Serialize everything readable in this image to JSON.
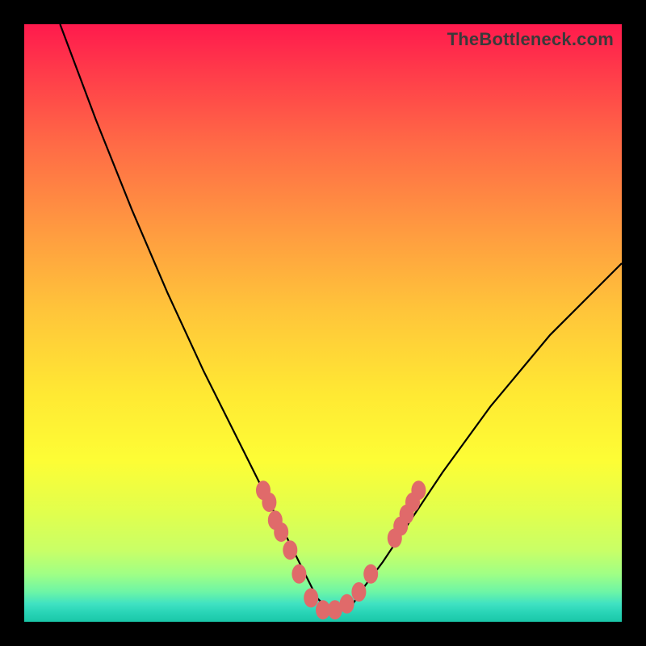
{
  "watermark": "TheBottleneck.com",
  "chart_data": {
    "type": "line",
    "title": "",
    "xlabel": "",
    "ylabel": "",
    "xlim": [
      0,
      100
    ],
    "ylim": [
      0,
      100
    ],
    "series": [
      {
        "name": "curve",
        "x": [
          6,
          12,
          18,
          24,
          30,
          36,
          40,
          44,
          47,
          49,
          51,
          53,
          55,
          57,
          60,
          64,
          70,
          78,
          88,
          100
        ],
        "y": [
          100,
          84,
          69,
          55,
          42,
          30,
          22,
          14,
          8,
          4,
          2,
          2,
          3,
          6,
          10,
          16,
          25,
          36,
          48,
          60
        ]
      }
    ],
    "markers": {
      "name": "highlight-dots",
      "color": "#e06a6a",
      "points": [
        {
          "x": 40,
          "y": 22
        },
        {
          "x": 41,
          "y": 20
        },
        {
          "x": 42,
          "y": 17
        },
        {
          "x": 43,
          "y": 15
        },
        {
          "x": 44.5,
          "y": 12
        },
        {
          "x": 46,
          "y": 8
        },
        {
          "x": 48,
          "y": 4
        },
        {
          "x": 50,
          "y": 2
        },
        {
          "x": 52,
          "y": 2
        },
        {
          "x": 54,
          "y": 3
        },
        {
          "x": 56,
          "y": 5
        },
        {
          "x": 58,
          "y": 8
        },
        {
          "x": 62,
          "y": 14
        },
        {
          "x": 63,
          "y": 16
        },
        {
          "x": 64,
          "y": 18
        },
        {
          "x": 65,
          "y": 20
        },
        {
          "x": 66,
          "y": 22
        }
      ]
    }
  }
}
